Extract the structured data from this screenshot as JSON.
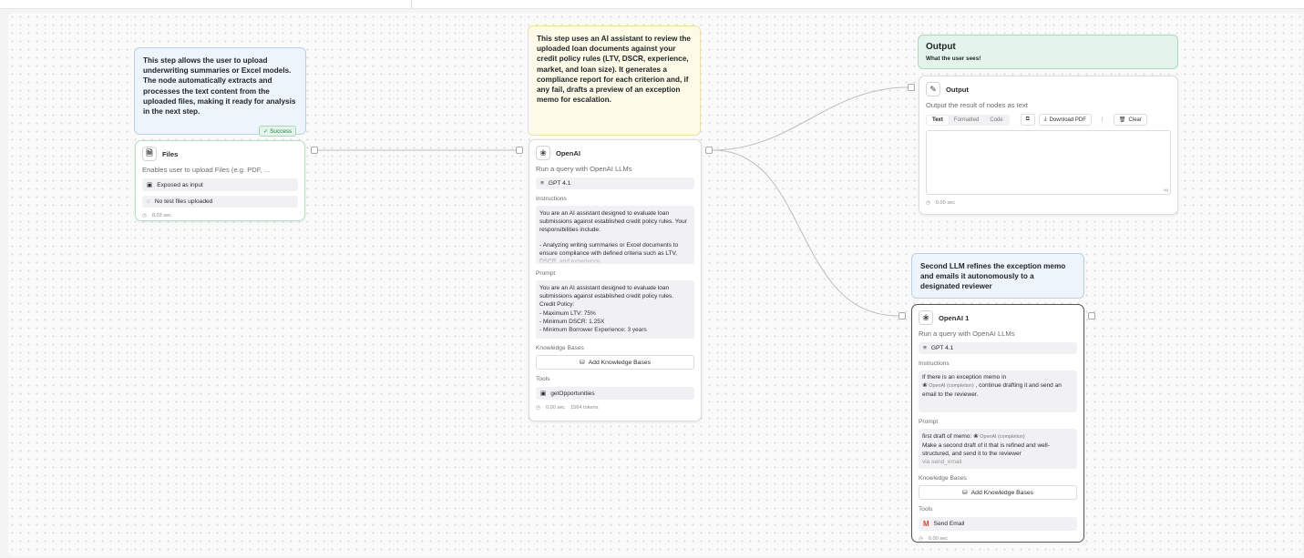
{
  "notes": {
    "files_note": "This step allows the user to upload underwriting summaries or Excel models. The node automatically extracts and processes the text content from the uploaded files, making it ready for analysis in the next step.",
    "openai_note": "This step uses an AI assistant to review the uploaded loan documents against your credit policy rules (LTV, DSCR, experience, market, and loan size). It generates a compliance report for each criterion and, if any fail, drafts a preview of an exception memo for escalation.",
    "output_note_title": "Output",
    "output_note_subtitle": "What the user sees!",
    "second_llm_note": "Second LLM refines the exception memo and emails it autonomously to a designated reviewer"
  },
  "files_node": {
    "badge": "✓ Success",
    "title": "Files",
    "description": "Enables user to upload Files (e.g. PDF, ...",
    "exposed": "Exposed as input",
    "no_test": "No test files uploaded",
    "time": "8.03 sec"
  },
  "openai_node": {
    "title": "OpenAI",
    "description": "Run a query with OpenAI LLMs",
    "model": "GPT 4.1",
    "instructions_label": "Instructions",
    "instructions_text": "You are an AI assistant designed to evaluate loan submissions against established credit policy rules. Your responsibilities include:",
    "instructions_text2": "- Analyzing writing summaries or Excel documents to ensure compliance with defined criteria such as LTV, DSCR, and experience.",
    "prompt_label": "Prompt",
    "prompt_text": "You are an AI assistant designed to evaluate loan submissions against established credit policy rules.",
    "prompt_lines": [
      "Credit Policy:",
      "- Maximum LTV: 75%",
      "- Minimum DSCR: 1.25X",
      "- Minimum Borrower Experience: 3 years"
    ],
    "kb_label": "Knowledge Bases",
    "kb_button": "Add Knowledge Bases",
    "tools_label": "Tools",
    "tool": "getOpportunities",
    "time": "0.00 sec",
    "tokens": "1564 tokens"
  },
  "output_node": {
    "title": "Output",
    "description": "Output the result of nodes as text",
    "tabs": [
      "Text",
      "Formatted",
      "Code"
    ],
    "download": "Download PDF",
    "more": "⋮",
    "clear": "Clear",
    "time": "0.00 sec"
  },
  "openai1_node": {
    "title": "OpenAI 1",
    "description": "Run a query with OpenAI LLMs",
    "model": "GPT 4.1",
    "instructions_label": "Instructions",
    "instr_pre": "If there is an exception memo in",
    "instr_ref": "OpenAI (completion)",
    "instr_post": ", continue drafting it and send an email to the reviewer.",
    "prompt_label": "Prompt",
    "prompt_pre": "first draft of memo:",
    "prompt_ref": "OpenAI (completion)",
    "prompt_post": "Make a second draft of it that is refined and well-structured, and send it to the reviewer",
    "prompt_tail": "via send_email",
    "kb_label": "Knowledge Bases",
    "kb_button": "Add Knowledge Bases",
    "tools_label": "Tools",
    "tool": "Send Email",
    "time": "0.00 sec"
  },
  "colors": {
    "note_blue": "#eef4fb",
    "note_yellow": "#fdfbe8",
    "note_green": "#e3f4ea",
    "success_text": "#2e7d4f"
  }
}
